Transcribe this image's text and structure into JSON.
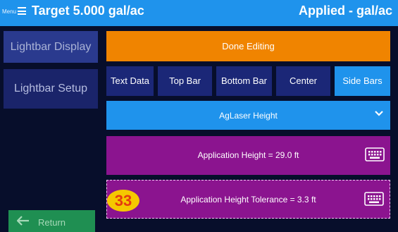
{
  "header": {
    "menu_label": "Menu",
    "target_text": "Target 5.000 gal/ac",
    "applied_text": "Applied - gal/ac"
  },
  "sidebar": {
    "items": [
      {
        "label": "Lightbar Display"
      },
      {
        "label": "Lightbar Setup"
      }
    ],
    "return_label": "Return"
  },
  "main": {
    "done_label": "Done Editing",
    "tabs": [
      {
        "label": "Text Data",
        "active": false
      },
      {
        "label": "Top Bar",
        "active": false
      },
      {
        "label": "Bottom Bar",
        "active": false
      },
      {
        "label": "Center",
        "active": false
      },
      {
        "label": "Side Bars",
        "active": true
      }
    ],
    "dropdown": {
      "selected": "AgLaser Height"
    },
    "fields": [
      {
        "label": "Application Height = 29.0 ft",
        "icon": "keyboard-icon"
      },
      {
        "label": "Application Height Tolerance = 3.3 ft",
        "icon": "keyboard-icon"
      }
    ],
    "badge_number": "33"
  },
  "colors": {
    "background": "#070e2b",
    "header": "#1f93ec",
    "done_button": "#f08400",
    "tab": "#1b2777",
    "tab_active": "#1f93ec",
    "field": "#8b148f",
    "return_button": "#1f8f52",
    "badge": "#f5c800"
  }
}
